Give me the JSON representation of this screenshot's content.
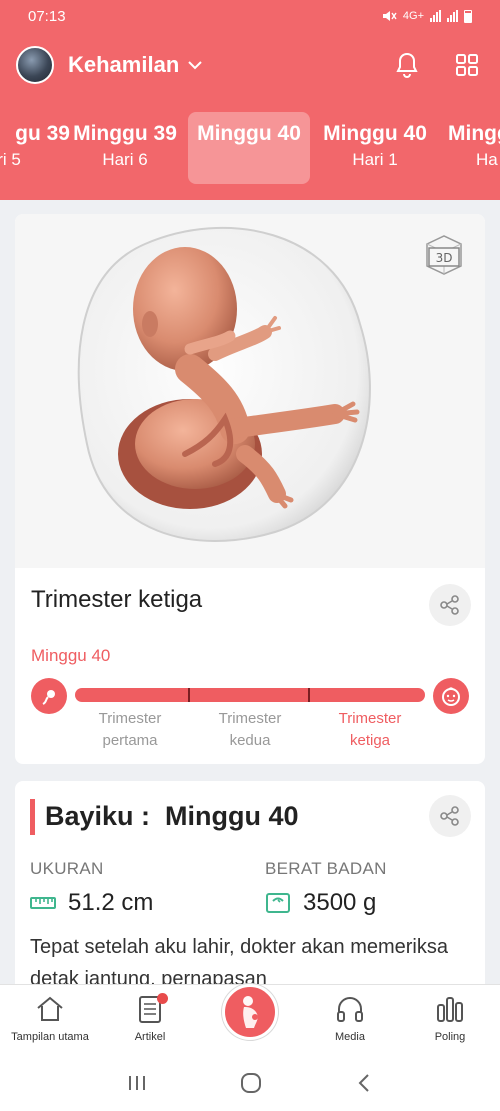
{
  "status": {
    "time": "07:13",
    "network": "4G+"
  },
  "header": {
    "title": "Kehamilan"
  },
  "weeks": [
    {
      "week": "gu 39",
      "day": "ri 5"
    },
    {
      "week": "Minggu 39",
      "day": "Hari 6"
    },
    {
      "week": "Minggu 40",
      "day": ""
    },
    {
      "week": "Minggu 40",
      "day": "Hari 1"
    },
    {
      "week": "Mingg",
      "day": "Ha"
    }
  ],
  "hero": {
    "badge": "3D"
  },
  "trimester": {
    "title": "Trimester ketiga",
    "week_label": "Minggu 40",
    "progress": 1.0,
    "labels": [
      "Trimester\npertama",
      "Trimester\nkedua",
      "Trimester\nketiga"
    ],
    "active_index": 2
  },
  "baby": {
    "title": "Bayiku :  Minggu 40",
    "size_label": "UKURAN",
    "size_value": "51.2 cm",
    "weight_label": "BERAT BADAN",
    "weight_value": "3500 g",
    "description": "Tepat setelah aku lahir, dokter akan memeriksa detak jantung, pernapasan"
  },
  "nav": {
    "home": "Tampilan utama",
    "articles": "Artikel",
    "media": "Media",
    "poll": "Poling"
  },
  "colors": {
    "accent": "#ef5d61",
    "header": "#f2676b"
  }
}
